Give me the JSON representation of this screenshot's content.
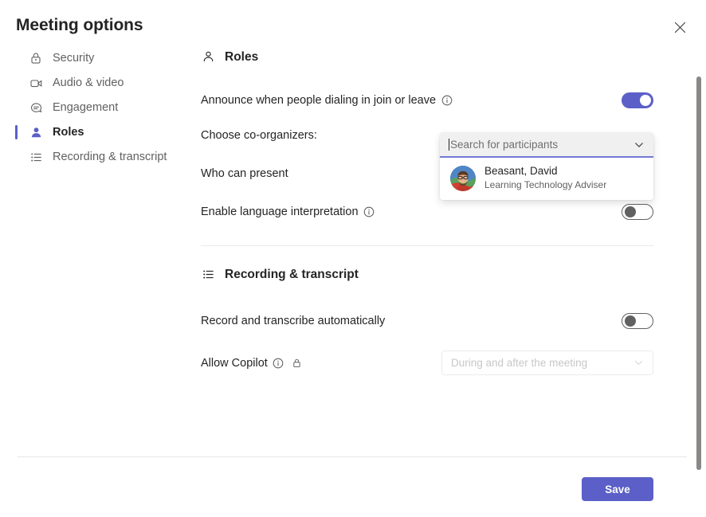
{
  "window": {
    "title": "Meeting options",
    "close_icon": "close-icon"
  },
  "sidebar": {
    "items": [
      {
        "label": "Security",
        "icon": "lock-icon",
        "active": false
      },
      {
        "label": "Audio & video",
        "icon": "video-camera-icon",
        "active": false
      },
      {
        "label": "Engagement",
        "icon": "chat-bubble-icon",
        "active": false
      },
      {
        "label": "Roles",
        "icon": "person-icon",
        "active": true
      },
      {
        "label": "Recording & transcript",
        "icon": "list-icon",
        "active": false
      }
    ]
  },
  "roles_section": {
    "heading": "Roles",
    "heading_icon": "person-outline-icon",
    "announce_label": "Announce when people dialing in join or leave",
    "announce_info_icon": "info-icon",
    "announce_toggle_state": "on",
    "co_organizers_label": "Choose co-organizers:",
    "who_can_present_label": "Who can present",
    "language_label": "Enable language interpretation",
    "language_info_icon": "info-icon",
    "language_toggle_state": "off"
  },
  "co_organizers_dropdown": {
    "placeholder": "Search for participants",
    "value": "",
    "chevron_icon": "chevron-down-icon",
    "suggestions": [
      {
        "name": "Beasant, David",
        "role": "Learning Technology Adviser",
        "avatar": "person-photo-avatar"
      }
    ]
  },
  "recording_section": {
    "heading": "Recording & transcript",
    "heading_icon": "list-icon",
    "record_label": "Record and transcribe automatically",
    "record_toggle_state": "off",
    "copilot_label": "Allow Copilot",
    "copilot_info_icon": "info-icon",
    "copilot_lock_icon": "lock-icon",
    "copilot_select_value": "During and after the meeting",
    "copilot_select_chevron": "chevron-down-icon"
  },
  "footer": {
    "save_label": "Save"
  },
  "colors": {
    "accent": "#5B5FC7",
    "text_primary": "#242424",
    "text_secondary": "#616161",
    "divider": "#EBEBEB",
    "field_bg": "#F0F0F0"
  }
}
